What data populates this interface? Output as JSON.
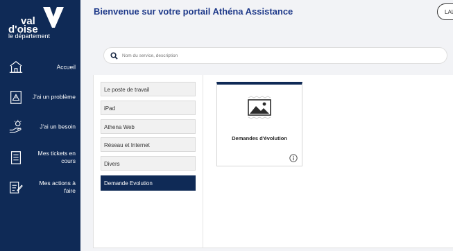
{
  "brand": {
    "line1": "val",
    "line2": "d'oise",
    "line3": "le département"
  },
  "header": {
    "title": "Bienvenue sur votre portail Athéna Assistance",
    "user_initials": "LAU"
  },
  "search": {
    "placeholder": "Nom du service, description"
  },
  "sidebar": {
    "items": [
      {
        "label": "Accueil",
        "icon": "home-icon"
      },
      {
        "label": "J'ai un problème",
        "icon": "warning-icon"
      },
      {
        "label": "J'ai un besoin",
        "icon": "hand-idea-icon"
      },
      {
        "label": "Mes tickets en cours",
        "icon": "ticket-list-icon"
      },
      {
        "label": "Mes actions à faire",
        "icon": "actions-icon"
      }
    ]
  },
  "categories": [
    {
      "label": "Le poste de travail",
      "active": false
    },
    {
      "label": "iPad",
      "active": false
    },
    {
      "label": "Athena Web",
      "active": false
    },
    {
      "label": "Réseau et Internet",
      "active": false
    },
    {
      "label": "Divers",
      "active": false
    },
    {
      "label": "Demande Evolution",
      "active": true
    }
  ],
  "services": [
    {
      "title": "Demandes d'évolution",
      "icon": "image-placeholder-icon"
    }
  ],
  "colors": {
    "navy": "#0f2a56",
    "title_blue": "#1f3a8a"
  }
}
